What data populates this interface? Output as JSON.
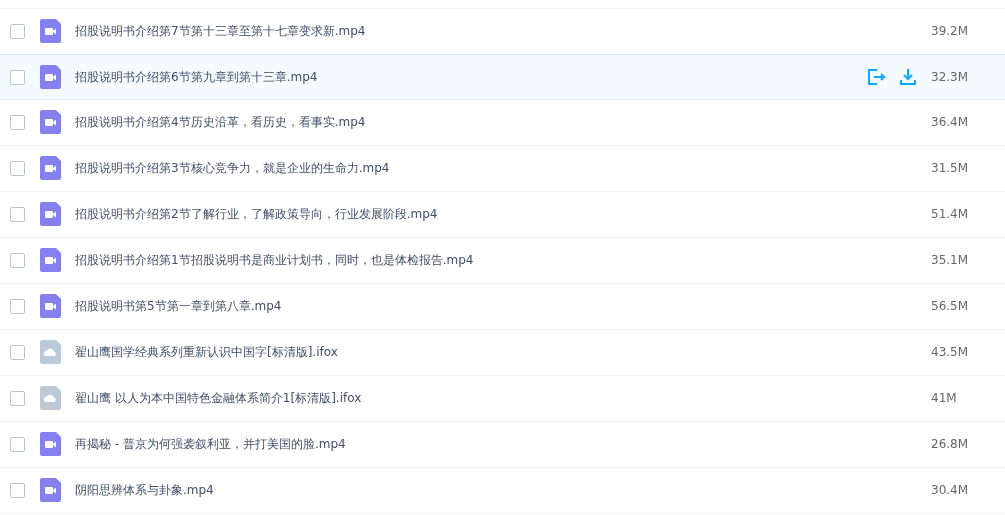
{
  "files": [
    {
      "name": "招股说明书介绍第7节第十三章至第十七章变求新.mp4",
      "size": "39.2M",
      "kind": "video",
      "checked": false,
      "highlighted": false
    },
    {
      "name": "招股说明书介绍第6节第九章到第十三章.mp4",
      "size": "32.3M",
      "kind": "video",
      "checked": false,
      "highlighted": true
    },
    {
      "name": "招股说明书介绍第4节历史沿革，看历史，看事实.mp4",
      "size": "36.4M",
      "kind": "video",
      "checked": false,
      "highlighted": false
    },
    {
      "name": "招股说明书介绍第3节核心竞争力，就是企业的生命力.mp4",
      "size": "31.5M",
      "kind": "video",
      "checked": false,
      "highlighted": false
    },
    {
      "name": "招股说明书介绍第2节了解行业，了解政策导向，行业发展阶段.mp4",
      "size": "51.4M",
      "kind": "video",
      "checked": false,
      "highlighted": false
    },
    {
      "name": "招股说明书介绍第1节招股说明书是商业计划书，同时，也是体检报告.mp4",
      "size": "35.1M",
      "kind": "video",
      "checked": false,
      "highlighted": false
    },
    {
      "name": "招股说明书第5节第一章到第八章.mp4",
      "size": "56.5M",
      "kind": "video",
      "checked": false,
      "highlighted": false
    },
    {
      "name": "翟山鹰国学经典系列重新认识中国字[标清版].ifox",
      "size": "43.5M",
      "kind": "cloud",
      "checked": false,
      "highlighted": false
    },
    {
      "name": "翟山鹰 以人为本中国特色金融体系简介1[标清版].ifox",
      "size": "41M",
      "kind": "cloud",
      "checked": false,
      "highlighted": false
    },
    {
      "name": "再揭秘 - 普京为何强袭叙利亚，并打美国的脸.mp4",
      "size": "26.8M",
      "kind": "video",
      "checked": false,
      "highlighted": false
    },
    {
      "name": "阴阳思辨体系与卦象.mp4",
      "size": "30.4M",
      "kind": "video",
      "checked": false,
      "highlighted": false
    }
  ]
}
